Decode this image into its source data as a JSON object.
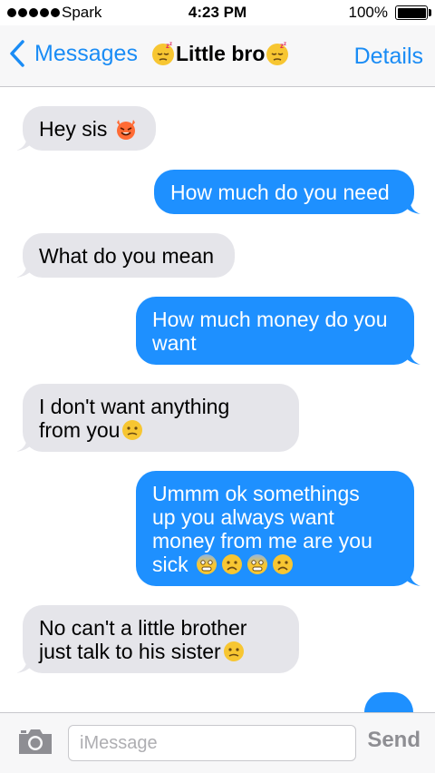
{
  "status_bar": {
    "carrier": "Spark",
    "time": "4:23 PM",
    "battery": "100%",
    "battery_level": 1.0,
    "signal_bars": 5
  },
  "nav": {
    "back_label": "Messages",
    "title": "Little bro",
    "title_emoji": "sleepy-face-emoji",
    "details_label": "Details"
  },
  "messages": [
    {
      "direction": "incoming",
      "lines": [
        "Hey sis"
      ],
      "emojis": [
        "smiling-devil-emoji"
      ]
    },
    {
      "direction": "outgoing",
      "lines": [
        "How much do you need"
      ]
    },
    {
      "direction": "incoming",
      "lines": [
        "What do you mean"
      ]
    },
    {
      "direction": "outgoing",
      "lines": [
        "How much money do you",
        "want"
      ]
    },
    {
      "direction": "incoming",
      "lines": [
        "I don't want anything",
        "from you"
      ],
      "emojis": [
        "confused-face-emoji"
      ]
    },
    {
      "direction": "outgoing",
      "lines": [
        "Ummm ok somethings",
        "up you always want",
        "money from me are you",
        "sick"
      ],
      "emojis": [
        "fearful-face-emoji",
        "worried-face-emoji",
        "fearful-face-emoji",
        "worried-face-emoji"
      ]
    },
    {
      "direction": "incoming",
      "lines": [
        "No can't a little brother",
        "just talk to his sister"
      ],
      "emojis": [
        "confused-face-emoji"
      ]
    }
  ],
  "input": {
    "placeholder": "iMessage",
    "send_label": "Send",
    "camera_icon": "camera-icon"
  },
  "colors": {
    "accent": "#1a8cf5",
    "outgoing_bubble": "#1e90ff",
    "incoming_bubble": "#e5e5ea",
    "emoji_face": "#f7c632"
  }
}
